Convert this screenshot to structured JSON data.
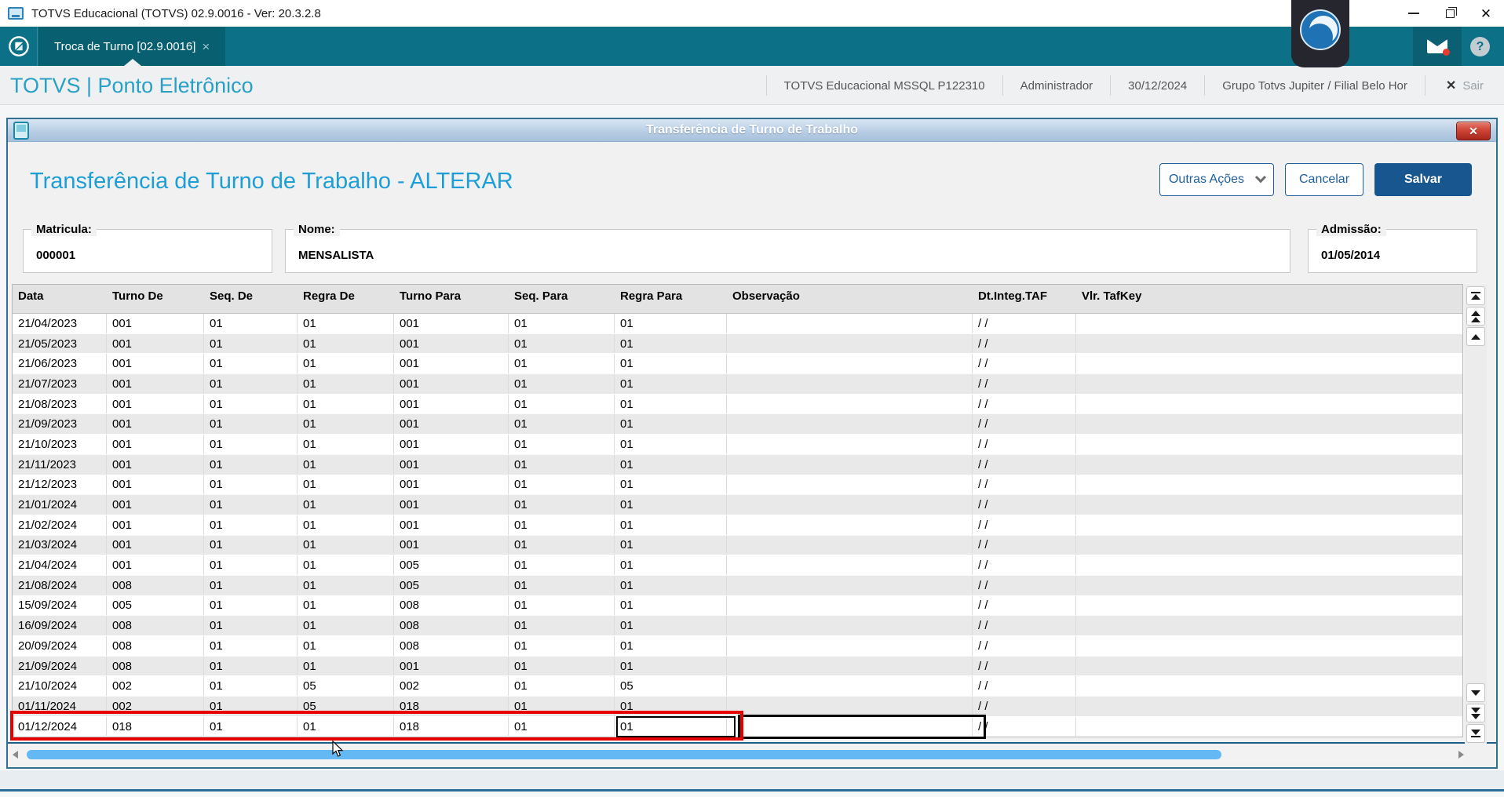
{
  "window": {
    "title": "TOTVS Educacional (TOTVS) 02.9.0016 - Ver: 20.3.2.8"
  },
  "icons": {
    "close": "✕",
    "tab_close": "×",
    "sair_x": "✕",
    "help": "?",
    "dialog_close": "✕"
  },
  "tabbar": {
    "active_tab": "Troca de Turno [02.9.0016]"
  },
  "header": {
    "title": "TOTVS | Ponto Eletrônico",
    "env": "TOTVS Educacional MSSQL P122310",
    "user": "Administrador",
    "date": "30/12/2024",
    "company": "Grupo Totvs Jupiter / Filial Belo Hor",
    "logout": "Sair"
  },
  "dialog": {
    "title": "Transferência de Turno de Trabalho",
    "heading": "Transferência de Turno de Trabalho - ALTERAR",
    "buttons": {
      "other_actions": "Outras Ações",
      "cancel": "Cancelar",
      "save": "Salvar"
    },
    "fields": [
      {
        "label": "Matricula:",
        "value": "000001"
      },
      {
        "label": "Nome:",
        "value": "MENSALISTA"
      },
      {
        "label": "Admissão:",
        "value": "01/05/2014"
      }
    ],
    "table": {
      "columns": [
        "Data",
        "Turno De",
        "Seq. De",
        "Regra De",
        "Turno Para",
        "Seq. Para",
        "Regra Para",
        "Observação",
        "Dt.Integ.TAF",
        "Vlr. TafKey"
      ],
      "rows": [
        [
          "21/04/2023",
          "001",
          "01",
          "01",
          "001",
          "01",
          "01",
          "",
          "/ /",
          ""
        ],
        [
          "21/05/2023",
          "001",
          "01",
          "01",
          "001",
          "01",
          "01",
          "",
          "/ /",
          ""
        ],
        [
          "21/06/2023",
          "001",
          "01",
          "01",
          "001",
          "01",
          "01",
          "",
          "/ /",
          ""
        ],
        [
          "21/07/2023",
          "001",
          "01",
          "01",
          "001",
          "01",
          "01",
          "",
          "/ /",
          ""
        ],
        [
          "21/08/2023",
          "001",
          "01",
          "01",
          "001",
          "01",
          "01",
          "",
          "/ /",
          ""
        ],
        [
          "21/09/2023",
          "001",
          "01",
          "01",
          "001",
          "01",
          "01",
          "",
          "/ /",
          ""
        ],
        [
          "21/10/2023",
          "001",
          "01",
          "01",
          "001",
          "01",
          "01",
          "",
          "/ /",
          ""
        ],
        [
          "21/11/2023",
          "001",
          "01",
          "01",
          "001",
          "01",
          "01",
          "",
          "/ /",
          ""
        ],
        [
          "21/12/2023",
          "001",
          "01",
          "01",
          "001",
          "01",
          "01",
          "",
          "/ /",
          ""
        ],
        [
          "21/01/2024",
          "001",
          "01",
          "01",
          "001",
          "01",
          "01",
          "",
          "/ /",
          ""
        ],
        [
          "21/02/2024",
          "001",
          "01",
          "01",
          "001",
          "01",
          "01",
          "",
          "/ /",
          ""
        ],
        [
          "21/03/2024",
          "001",
          "01",
          "01",
          "001",
          "01",
          "01",
          "",
          "/ /",
          ""
        ],
        [
          "21/04/2024",
          "001",
          "01",
          "01",
          "005",
          "01",
          "01",
          "",
          "/ /",
          ""
        ],
        [
          "21/08/2024",
          "008",
          "01",
          "01",
          "005",
          "01",
          "01",
          "",
          "/ /",
          ""
        ],
        [
          "15/09/2024",
          "005",
          "01",
          "01",
          "008",
          "01",
          "01",
          "",
          "/ /",
          ""
        ],
        [
          "16/09/2024",
          "008",
          "01",
          "01",
          "008",
          "01",
          "01",
          "",
          "/ /",
          ""
        ],
        [
          "20/09/2024",
          "008",
          "01",
          "01",
          "008",
          "01",
          "01",
          "",
          "/ /",
          ""
        ],
        [
          "21/09/2024",
          "008",
          "01",
          "01",
          "001",
          "01",
          "01",
          "",
          "/ /",
          ""
        ],
        [
          "21/10/2024",
          "002",
          "01",
          "05",
          "002",
          "01",
          "05",
          "",
          "/ /",
          ""
        ],
        [
          "01/11/2024",
          "002",
          "01",
          "05",
          "018",
          "01",
          "01",
          "",
          "/ /",
          ""
        ],
        [
          "01/12/2024",
          "018",
          "01",
          "01",
          "018",
          "01",
          "01",
          "",
          "/ /",
          ""
        ]
      ],
      "state": {
        "highlighted_row_date": "01/12/2024",
        "highlight_color": "#e60000",
        "focused_column": "Regra Para",
        "selected_cell_column": "Observação"
      }
    }
  },
  "colors": {
    "brand_teal": "#0c7086",
    "active_tab_teal": "#085f70",
    "accent_blue": "#1e9ed6",
    "button_blue": "#1f5f9e",
    "save_button_bg": "#17568f",
    "highlight_red": "#e60000",
    "scroll_thumb_blue": "#64b9f4",
    "dialog_titlebar_blue": "#b6cce3"
  }
}
